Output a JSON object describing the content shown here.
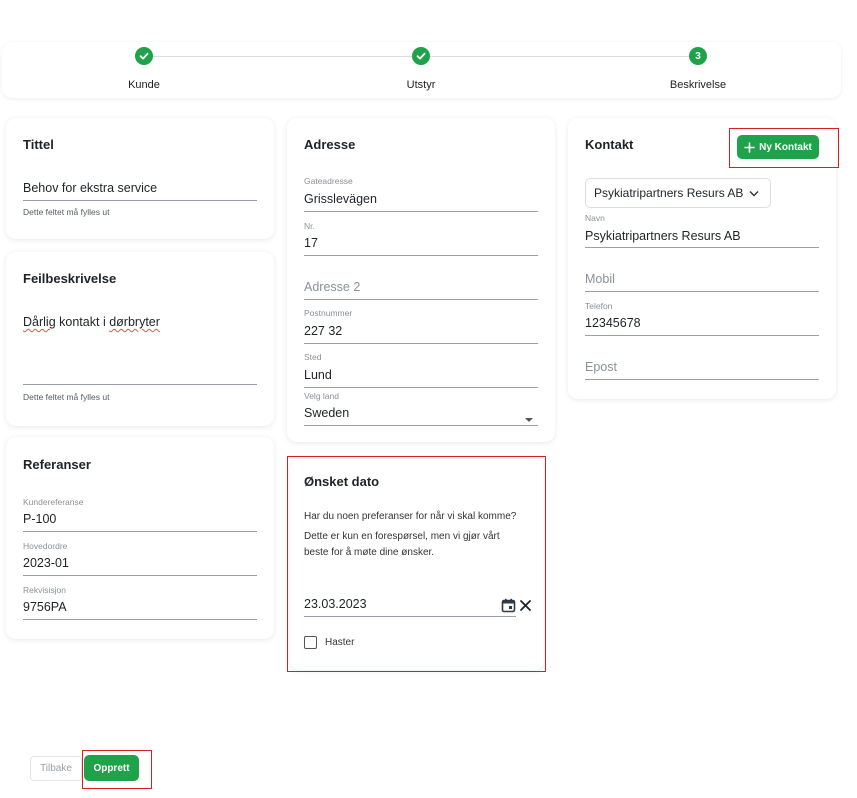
{
  "stepper": {
    "steps": [
      {
        "label": "Kunde",
        "state": "done"
      },
      {
        "label": "Utstyr",
        "state": "done"
      },
      {
        "label": "Beskrivelse",
        "state": "active",
        "number": "3"
      }
    ]
  },
  "tittel": {
    "title": "Tittel",
    "value": "Behov for ekstra service",
    "helper": "Dette feltet må fylles ut"
  },
  "feilbeskrivelse": {
    "title": "Feilbeskrivelse",
    "value_word1": "Dårlig",
    "value_word2": "kontakt",
    "value_word3": "i",
    "value_word4": "dørbryter",
    "helper": "Dette feltet må fylles ut"
  },
  "referanser": {
    "title": "Referanser",
    "kundereferanse_label": "Kundereferanse",
    "kundereferanse_value": "P-100",
    "hovedordre_label": "Hovedordre",
    "hovedordre_value": "2023-01",
    "rekvisisjon_label": "Rekvisisjon",
    "rekvisisjon_value": "9756PA"
  },
  "adresse": {
    "title": "Adresse",
    "gateadresse_label": "Gateadresse",
    "gateadresse_value": "Grisslevägen",
    "nr_label": "Nr.",
    "nr_value": "17",
    "adresse2_placeholder": "Adresse 2",
    "postnummer_label": "Postnummer",
    "postnummer_value": "227 32",
    "sted_label": "Sted",
    "sted_value": "Lund",
    "land_label": "Velg land",
    "land_value": "Sweden"
  },
  "onsket_dato": {
    "title": "Ønsket dato",
    "question": "Har du noen preferanser for når vi skal komme?",
    "description_line1": "Dette er kun en forespørsel, men vi gjør vårt",
    "description_line2": "beste for å møte dine ønsker.",
    "date_value": "23.03.2023",
    "haster_label": "Haster",
    "haster_checked": false
  },
  "kontakt": {
    "title": "Kontakt",
    "new_button_label": "Ny Kontakt",
    "selected_company": "Psykiatripartners Resurs AB",
    "navn_label": "Navn",
    "navn_value": "Psykiatripartners Resurs AB",
    "mobil_placeholder": "Mobil",
    "telefon_label": "Telefon",
    "telefon_value": "12345678",
    "epost_placeholder": "Epost"
  },
  "footer": {
    "back_label": "Tilbake",
    "create_label": "Opprett"
  },
  "colors": {
    "accent": "#1fa34a",
    "highlight_border": "#d32020"
  },
  "icons": [
    "check-icon",
    "chevron-down-icon",
    "caret-down-icon",
    "calendar-icon",
    "close-icon",
    "plus-icon"
  ]
}
